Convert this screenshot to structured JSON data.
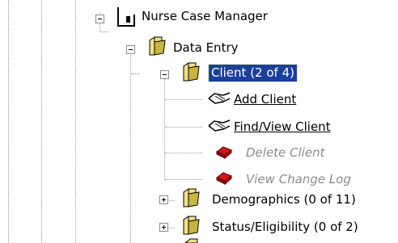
{
  "tree": {
    "root": {
      "label": "Nurse Case Manager",
      "icon": "case-manager-icon"
    },
    "data_entry": {
      "label": "Data Entry",
      "icon": "folder-open-icon"
    },
    "client": {
      "label": "Client (2 of 4)",
      "icon": "folder-open-icon",
      "selected": true
    },
    "actions": [
      {
        "label": "Add Client",
        "icon": "handshake-icon",
        "enabled": true
      },
      {
        "label": "Find/View Client",
        "icon": "handshake-icon",
        "enabled": true
      },
      {
        "label": "Delete Client",
        "icon": "red-book-icon",
        "enabled": false
      },
      {
        "label": "View Change Log",
        "icon": "red-book-icon",
        "enabled": false
      }
    ],
    "demographics": {
      "label": "Demographics (0 of 11)",
      "icon": "folder-icon"
    },
    "status": {
      "label": "Status/Eligibility (0 of 2)",
      "icon": "folder-icon"
    }
  },
  "colors": {
    "selection": "#1b3f9e",
    "disabled_text": "#8c8c8c",
    "tree_lines": "#9a9a9a"
  }
}
